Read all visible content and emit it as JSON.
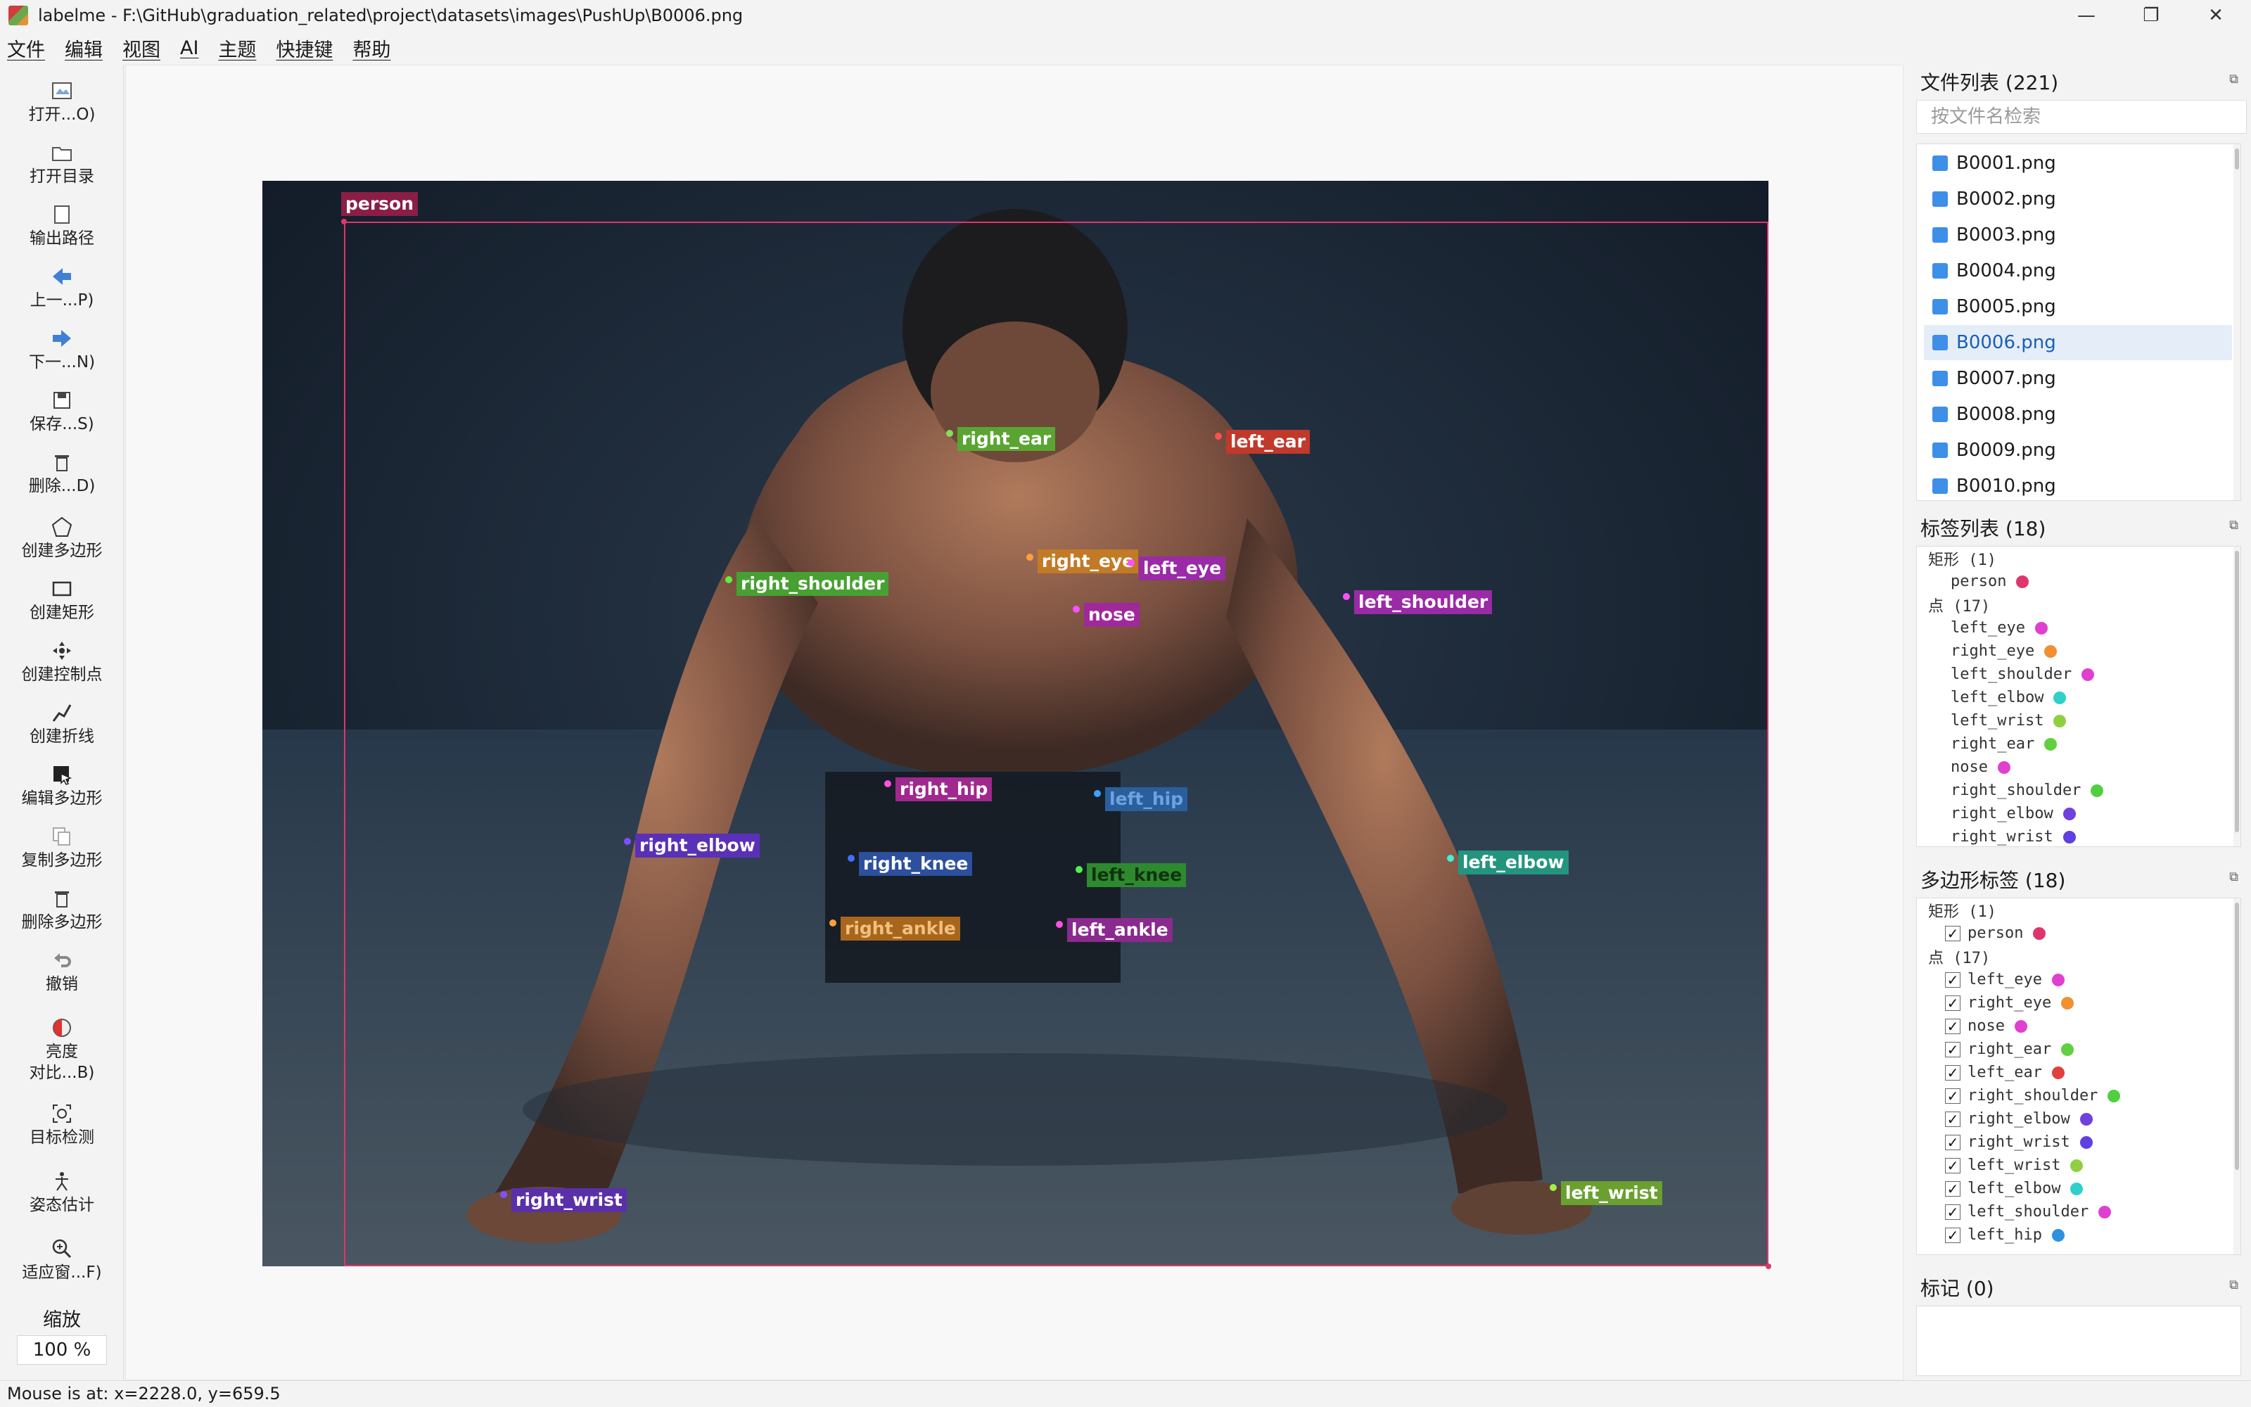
{
  "window": {
    "title": "labelme - F:\\GitHub\\graduation_related\\project\\datasets\\images\\PushUp\\B0006.png",
    "minimize_icon": "minimize-icon",
    "maximize_icon": "restore-icon",
    "close_icon": "close-icon"
  },
  "menu": [
    "文件",
    "编辑",
    "视图",
    "AI",
    "主题",
    "快捷键",
    "帮助"
  ],
  "toolbar": {
    "tools": [
      {
        "label": "打开...O)",
        "icon": "open-file-icon"
      },
      {
        "label": "打开目录",
        "icon": "open-dir-icon"
      },
      {
        "label": "输出路径",
        "icon": "output-path-icon"
      },
      {
        "label": "上一...P)",
        "icon": "prev-icon"
      },
      {
        "label": "下一...N)",
        "icon": "next-icon"
      },
      {
        "label": "保存...S)",
        "icon": "save-icon"
      },
      {
        "label": "删除...D)",
        "icon": "delete-icon"
      },
      {
        "label": "创建多边形",
        "icon": "polygon-icon"
      },
      {
        "label": "创建矩形",
        "icon": "rectangle-icon"
      },
      {
        "label": "创建控制点",
        "icon": "point-icon"
      },
      {
        "label": "创建折线",
        "icon": "polyline-icon"
      },
      {
        "label": "编辑多边形",
        "icon": "edit-polygon-icon"
      },
      {
        "label": "复制多边形",
        "icon": "copy-polygon-icon"
      },
      {
        "label": "删除多边形",
        "icon": "delete-polygon-icon"
      },
      {
        "label": "撤销",
        "icon": "undo-icon"
      },
      {
        "label": "亮度\n对比...B)",
        "icon": "brightness-icon"
      },
      {
        "label": "目标检测",
        "icon": "detection-icon"
      },
      {
        "label": "姿态估计",
        "icon": "pose-icon"
      },
      {
        "label": "适应窗...F)",
        "icon": "fit-window-icon"
      }
    ],
    "zoom_label": "缩放",
    "zoom_value": "100 %"
  },
  "canvas": {
    "rect_label": "person",
    "keypoints": [
      {
        "name": "right_ear",
        "color": "#5aa531"
      },
      {
        "name": "left_ear",
        "color": "#c0392b"
      },
      {
        "name": "right_eye",
        "color": "#d98a2b"
      },
      {
        "name": "left_eye",
        "color": "#b62fbf"
      },
      {
        "name": "right_shoulder",
        "color": "#4bb03a"
      },
      {
        "name": "left_shoulder",
        "color": "#b02cb8"
      },
      {
        "name": "nose",
        "color": "#c42bb0"
      },
      {
        "name": "right_hip",
        "color": "#c02ba6"
      },
      {
        "name": "left_hip",
        "color": "#2f6fd1"
      },
      {
        "name": "right_elbow",
        "color": "#6a3ad1"
      },
      {
        "name": "right_knee",
        "color": "#2f5fcf"
      },
      {
        "name": "left_knee",
        "color": "#2fa83b"
      },
      {
        "name": "left_elbow",
        "color": "#2bbfa8"
      },
      {
        "name": "right_ankle",
        "color": "#d98a2b"
      },
      {
        "name": "left_ankle",
        "color": "#c02ba6"
      },
      {
        "name": "right_wrist",
        "color": "#6a3ad1"
      },
      {
        "name": "left_wrist",
        "color": "#7fc43a"
      }
    ],
    "rect_color": "#e0356b"
  },
  "file_panel": {
    "title": "文件列表 (221)",
    "search_placeholder": "按文件名检索",
    "files": [
      "B0001.png",
      "B0002.png",
      "B0003.png",
      "B0004.png",
      "B0005.png",
      "B0006.png",
      "B0007.png",
      "B0008.png",
      "B0009.png",
      "B0010.png"
    ],
    "selected": "B0006.png"
  },
  "label_panel": {
    "title": "标签列表 (18)",
    "group_rect": "矩形 (1)",
    "group_point": "点 (17)",
    "rect_items": [
      {
        "name": "person",
        "color": "#e0356b"
      }
    ],
    "point_items": [
      {
        "name": "left_eye",
        "color": "#e040d0"
      },
      {
        "name": "right_eye",
        "color": "#f09030"
      },
      {
        "name": "left_shoulder",
        "color": "#e040d0"
      },
      {
        "name": "left_elbow",
        "color": "#30d0c8"
      },
      {
        "name": "left_wrist",
        "color": "#90d040"
      },
      {
        "name": "right_ear",
        "color": "#60d040"
      },
      {
        "name": "nose",
        "color": "#e040d0"
      },
      {
        "name": "right_shoulder",
        "color": "#50d040"
      },
      {
        "name": "right_elbow",
        "color": "#7040e0"
      },
      {
        "name": "right_wrist",
        "color": "#6040e0"
      }
    ]
  },
  "polygon_panel": {
    "title": "多边形标签 (18)",
    "group_rect": "矩形 (1)",
    "group_point": "点 (17)",
    "rect_items": [
      {
        "name": "person",
        "color": "#e0356b"
      }
    ],
    "point_items": [
      {
        "name": "left_eye",
        "color": "#e040d0"
      },
      {
        "name": "right_eye",
        "color": "#f09030"
      },
      {
        "name": "nose",
        "color": "#e040d0"
      },
      {
        "name": "right_ear",
        "color": "#60d040"
      },
      {
        "name": "left_ear",
        "color": "#e04040"
      },
      {
        "name": "right_shoulder",
        "color": "#50d040"
      },
      {
        "name": "right_elbow",
        "color": "#7040e0"
      },
      {
        "name": "right_wrist",
        "color": "#6040e0"
      },
      {
        "name": "left_wrist",
        "color": "#90d040"
      },
      {
        "name": "left_elbow",
        "color": "#30d0c8"
      },
      {
        "name": "left_shoulder",
        "color": "#e040d0"
      },
      {
        "name": "left_hip",
        "color": "#3090e0"
      }
    ]
  },
  "marks_panel": {
    "title": "标记 (0)"
  },
  "status": {
    "text": "Mouse is at: x=2228.0, y=659.5"
  }
}
